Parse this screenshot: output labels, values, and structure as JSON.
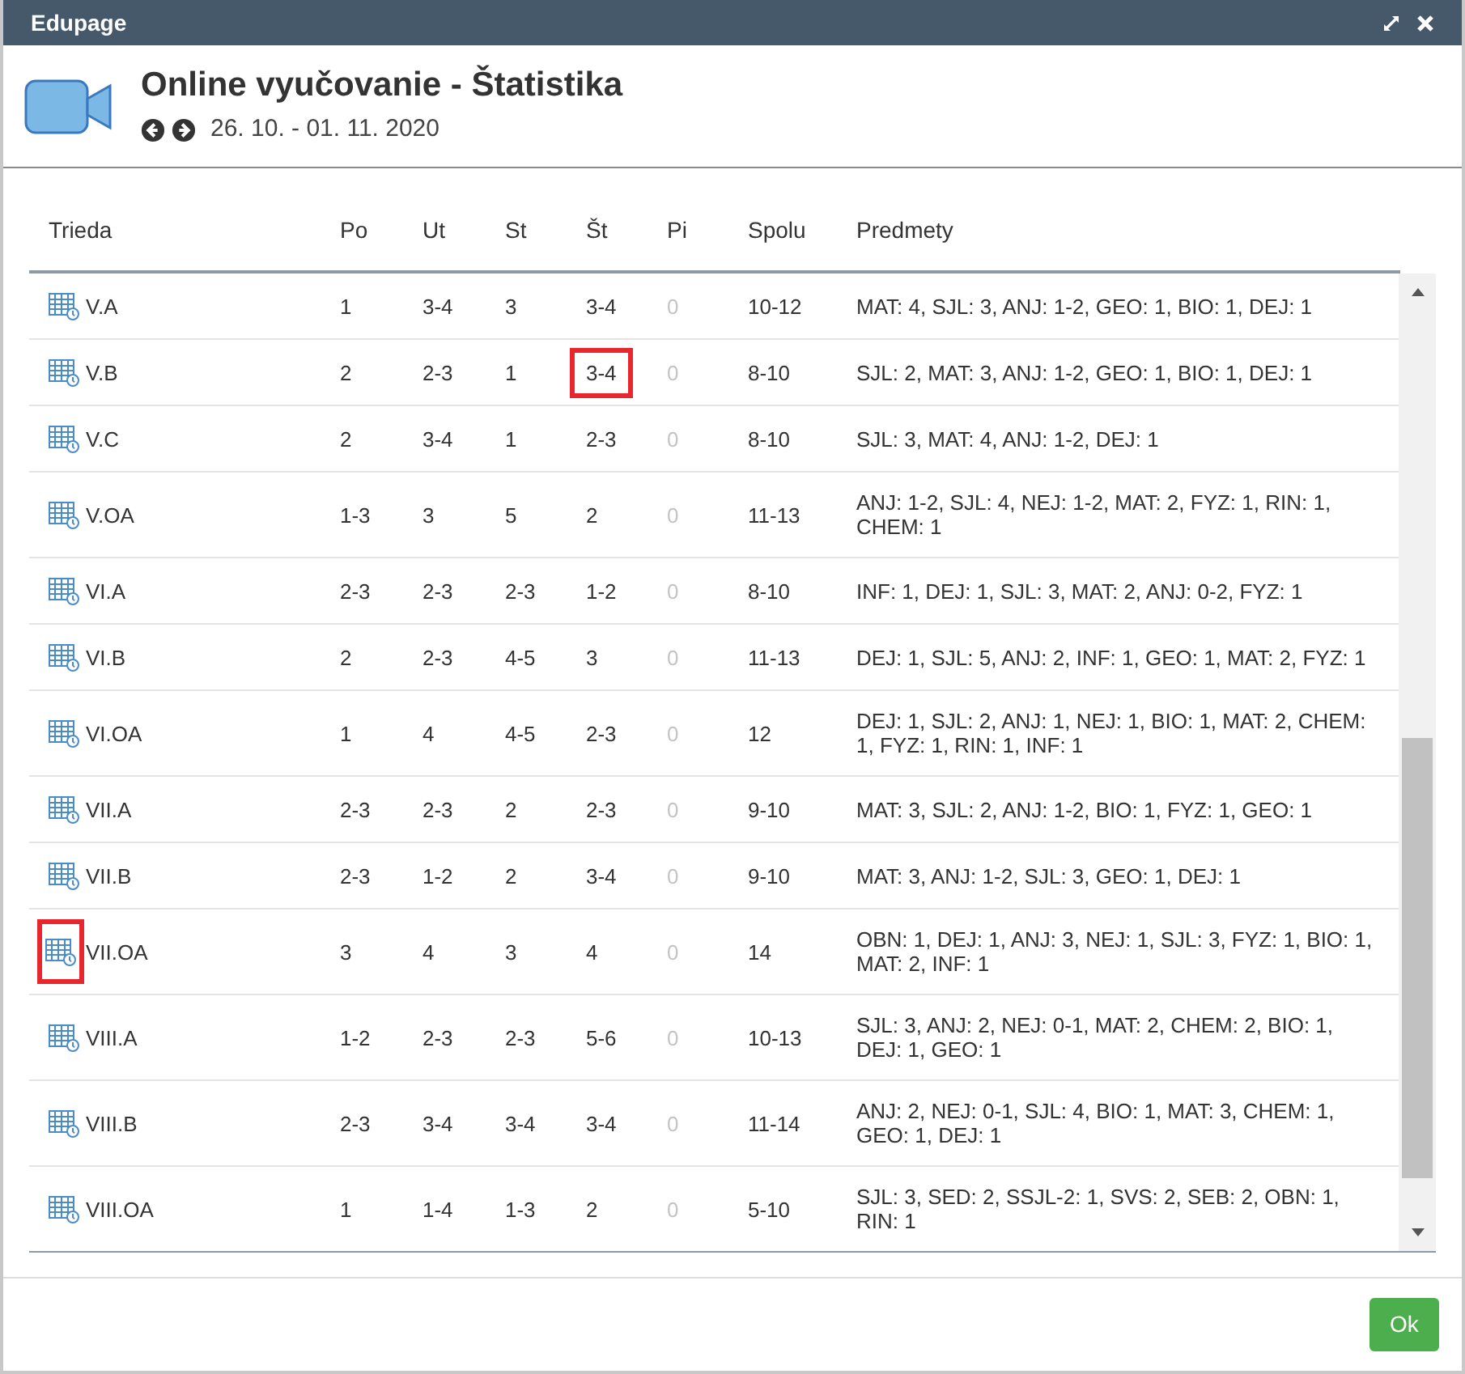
{
  "window": {
    "title": "Edupage"
  },
  "header": {
    "title": "Online vyučovanie - Štatistika",
    "date_range": "26. 10. - 01. 11. 2020"
  },
  "table": {
    "columns": [
      {
        "label": "Trieda",
        "dimmed": false
      },
      {
        "label": "Po",
        "dimmed": false
      },
      {
        "label": "Ut",
        "dimmed": false
      },
      {
        "label": "St",
        "dimmed": false
      },
      {
        "label": "Št",
        "dimmed": false
      },
      {
        "label": "Pi",
        "dimmed": true
      },
      {
        "label": "Spolu",
        "dimmed": false
      },
      {
        "label": "Predmety",
        "dimmed": false
      }
    ],
    "rows": [
      {
        "class": "V.A",
        "days": [
          "1",
          "3-4",
          "3",
          "3-4",
          "0"
        ],
        "total": "10-12",
        "subjects": "MAT: 4, SJL: 3, ANJ: 1-2, GEO: 1, BIO: 1, DEJ: 1"
      },
      {
        "class": "V.B",
        "days": [
          "2",
          "2-3",
          "1",
          "3-4",
          "0"
        ],
        "total": "8-10",
        "subjects": "SJL: 2, MAT: 3, ANJ: 1-2, GEO: 1, BIO: 1, DEJ: 1",
        "highlight": {
          "kind": "thursday_cell"
        }
      },
      {
        "class": "V.C",
        "days": [
          "2",
          "3-4",
          "1",
          "2-3",
          "0"
        ],
        "total": "8-10",
        "subjects": "SJL: 3, MAT: 4, ANJ: 1-2, DEJ: 1"
      },
      {
        "class": "V.OA",
        "days": [
          "1-3",
          "3",
          "5",
          "2",
          "0"
        ],
        "total": "11-13",
        "subjects": "ANJ: 1-2, SJL: 4, NEJ: 1-2, MAT: 2, FYZ: 1, RIN: 1, CHEM: 1"
      },
      {
        "class": "VI.A",
        "days": [
          "2-3",
          "2-3",
          "2-3",
          "1-2",
          "0"
        ],
        "total": "8-10",
        "subjects": "INF: 1, DEJ: 1, SJL: 3, MAT: 2, ANJ: 0-2, FYZ: 1"
      },
      {
        "class": "VI.B",
        "days": [
          "2",
          "2-3",
          "4-5",
          "3",
          "0"
        ],
        "total": "11-13",
        "subjects": "DEJ: 1, SJL: 5, ANJ: 2, INF: 1, GEO: 1, MAT: 2, FYZ: 1"
      },
      {
        "class": "VI.OA",
        "days": [
          "1",
          "4",
          "4-5",
          "2-3",
          "0"
        ],
        "total": "12",
        "subjects": "DEJ: 1, SJL: 2, ANJ: 1, NEJ: 1, BIO: 1, MAT: 2, CHEM: 1, FYZ: 1, RIN: 1, INF: 1"
      },
      {
        "class": "VII.A",
        "days": [
          "2-3",
          "2-3",
          "2",
          "2-3",
          "0"
        ],
        "total": "9-10",
        "subjects": "MAT: 3, SJL: 2, ANJ: 1-2, BIO: 1, FYZ: 1, GEO: 1"
      },
      {
        "class": "VII.B",
        "days": [
          "2-3",
          "1-2",
          "2",
          "3-4",
          "0"
        ],
        "total": "9-10",
        "subjects": "MAT: 3, ANJ: 1-2, SJL: 3, GEO: 1, DEJ: 1"
      },
      {
        "class": "VII.OA",
        "days": [
          "3",
          "4",
          "3",
          "4",
          "0"
        ],
        "total": "14",
        "subjects": "OBN: 1, DEJ: 1, ANJ: 3, NEJ: 1, SJL: 3, FYZ: 1, BIO: 1, MAT: 2, INF: 1",
        "highlight": {
          "kind": "icon"
        }
      },
      {
        "class": "VIII.A",
        "days": [
          "1-2",
          "2-3",
          "2-3",
          "5-6",
          "0"
        ],
        "total": "10-13",
        "subjects": "SJL: 3, ANJ: 2, NEJ: 0-1, MAT: 2, CHEM: 2, BIO: 1, DEJ: 1, GEO: 1"
      },
      {
        "class": "VIII.B",
        "days": [
          "2-3",
          "3-4",
          "3-4",
          "3-4",
          "0"
        ],
        "total": "11-14",
        "subjects": "ANJ: 2, NEJ: 0-1, SJL: 4, BIO: 1, MAT: 3, CHEM: 1, GEO: 1, DEJ: 1"
      },
      {
        "class": "VIII.OA",
        "days": [
          "1",
          "1-4",
          "1-3",
          "2",
          "0"
        ],
        "total": "5-10",
        "subjects": "SJL: 3, SED: 2, SSJL-2: 1, SVS: 2, SEB: 2, OBN: 1, RIN: 1"
      }
    ]
  },
  "footer": {
    "button": "Ok"
  }
}
